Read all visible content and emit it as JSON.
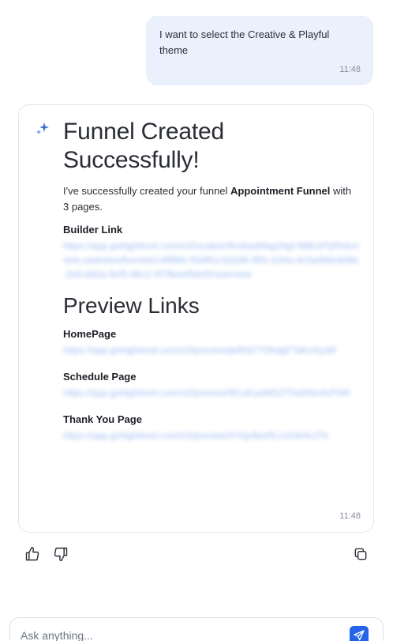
{
  "user_message": {
    "text": "I want to select the Creative & Playful theme",
    "time": "11:48"
  },
  "ai_message": {
    "heading": "Funnel Created Successfully!",
    "intro_prefix": "I've successfully created your funnel ",
    "funnel_name": "Appointment Funnel",
    "intro_suffix": " with 3 pages.",
    "builder_label": "Builder Link",
    "builder_link": "https://app.gohighlevel.com/v2/location/lhcbwdAbgzNgl-N8KsPQRsfunnels-websites/funnels/c4f98fe-f0d9f1c3d2d8-4f0c-b34a-4c5a4b6c8d9e-2e6-b82a-9cf5-9bc1-0f7fbeef5dcf2/overview",
    "preview_heading": "Preview Links",
    "pages": [
      {
        "label": "HomePage",
        "link": "https://app.gohighlevel.com/v2/preview/jwRrb7Y0hdgFTaKn0yzM"
      },
      {
        "label": "Schedule Page",
        "link": "https://app.gohighlevel.com/v2/preview/8CuKuaWG2T5wDbe4uFhM"
      },
      {
        "label": "Thank You Page",
        "link": "https://app.gohighlevel.com/v2/preview/hYkp4boRLUnGk4sJTb"
      }
    ],
    "time": "11:48"
  },
  "input": {
    "placeholder": "Ask anything..."
  },
  "colors": {
    "accent": "#2563eb",
    "user_bubble": "#eaf0fc",
    "link": "#4b85e8"
  },
  "icons": [
    "sparkle-icon",
    "thumbs-up-icon",
    "thumbs-down-icon",
    "copy-icon",
    "send-icon"
  ]
}
